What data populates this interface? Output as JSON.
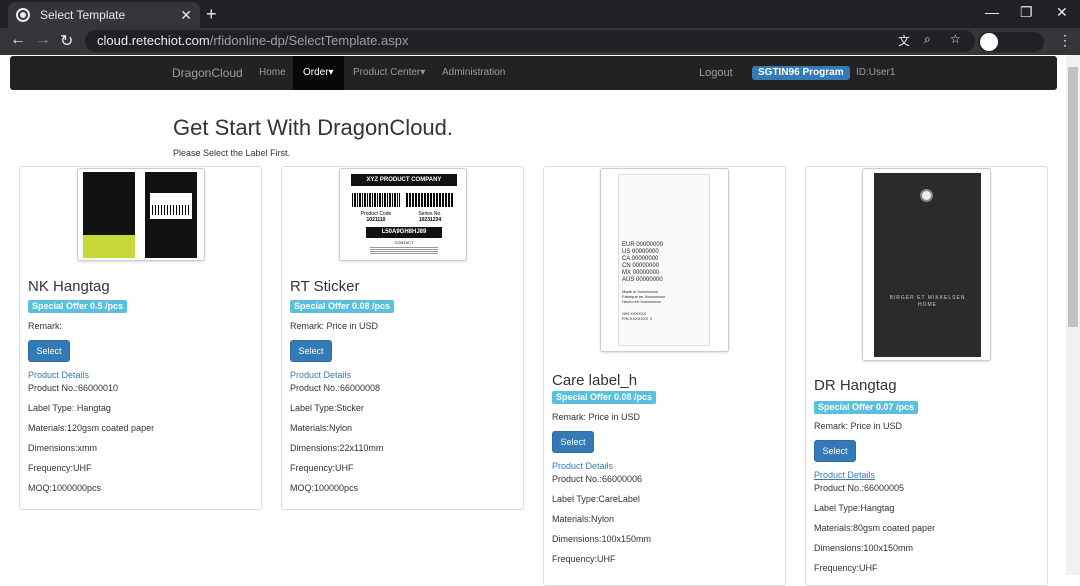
{
  "browser": {
    "tab_title": "Select Template",
    "url_host": "cloud.retechiot.com",
    "url_path": "/rfidonline-dp/SelectTemplate.aspx"
  },
  "nav": {
    "brand": "DragonCloud",
    "home": "Home",
    "order": "Order▾",
    "product_center": "Product Center▾",
    "administration": "Administration",
    "logout": "Logout",
    "program": "SGTIN96 Program",
    "user": "ID:User1"
  },
  "page": {
    "title": "Get Start With DragonCloud.",
    "subtitle": "Please Select the Label First."
  },
  "cards": [
    {
      "name": "NK Hangtag",
      "offer": "Special Offer 0.5 /pcs",
      "remark": "Remark:",
      "select": "Select",
      "details": "Product Details",
      "product_no": "Product No.:66000010",
      "label_type": "Label Type: Hangtag",
      "materials": "Materials:120gsm coated paper",
      "dimensions": "Dimensions:xmm",
      "frequency": "Frequency:UHF",
      "moq": "MOQ:1000000pcs"
    },
    {
      "name": "RT Sticker",
      "offer": "Special Offer 0.08 /pcs",
      "remark": "Remark: Price in USD",
      "select": "Select",
      "details": "Product Details",
      "product_no": "Product No.:66000008",
      "label_type": "Label Type:Sticker",
      "materials": "Materials:Nylon",
      "dimensions": "Dimensions:22x110mm",
      "frequency": "Frequency:UHF",
      "moq": "MOQ:100000pcs",
      "img": {
        "company": "XYZ PRODUCT COMPANY",
        "code_label": "Product Code",
        "code": "1021110",
        "series_label": "Series No.",
        "series": "10231234",
        "serial": "L50A9GH8HJ89",
        "contact": "CONTACT"
      }
    },
    {
      "name": "Care label_h",
      "offer": "Special Offer 0.08 /pcs",
      "remark": "Remark: Price in USD",
      "select": "Select",
      "details": "Product Details",
      "product_no": "Product No.:66000006",
      "label_type": "Label Type:CareLabel",
      "materials": "Materials:Nylon",
      "dimensions": "Dimensions:100x150mm",
      "frequency": "Frequency:UHF",
      "img": {
        "sizes": [
          "EUR 00000000",
          "US 00000000",
          "CA 00000000",
          "CN 00000000",
          "MX 00000000",
          "AUS 00000000"
        ],
        "made": [
          "Made in Xxxxxxxxxx",
          "Fabriqué en Xxxxxxxxxx",
          "Hecho en Xxxxxxxxxx"
        ],
        "codes": [
          "GIN XXXXXX",
          "P/N XXXXXXX X"
        ]
      }
    },
    {
      "name": "DR Hangtag",
      "offer": "Special Offer 0.07 /pcs",
      "remark": "Remark: Price in USD",
      "select": "Select",
      "details": "Product Details",
      "product_no": "Product No.:66000005",
      "label_type": "Label Type:Hangtag",
      "materials": "Materials:80gsm coated paper",
      "dimensions": "Dimensions:100x150mm",
      "frequency": "Frequency:UHF",
      "img": {
        "brand": "BIRGER ET MIKKELSEN",
        "brand2": "HOME"
      }
    }
  ]
}
